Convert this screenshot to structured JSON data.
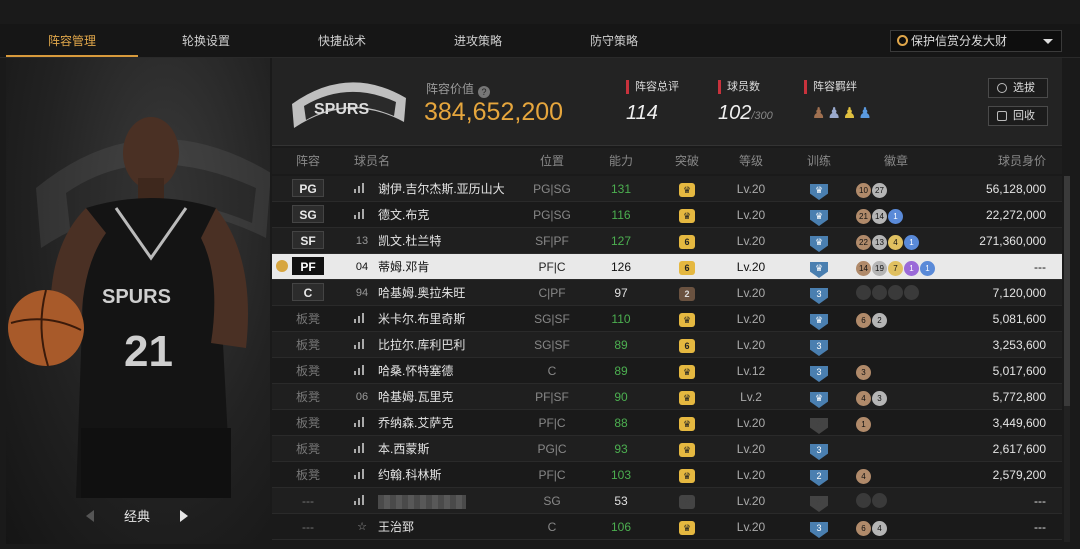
{
  "tabs": [
    {
      "label": "阵容管理",
      "active": true
    },
    {
      "label": "轮换设置",
      "active": false
    },
    {
      "label": "快捷战术",
      "active": false
    },
    {
      "label": "进攻策略",
      "active": false
    },
    {
      "label": "防守策略",
      "active": false
    }
  ],
  "dropdown": {
    "label": "保护信赏分发大财"
  },
  "left_nav": {
    "label": "经典"
  },
  "team": {
    "value_label": "阵容价值",
    "value": "384,652,200",
    "overall_label": "阵容总评",
    "overall": "114",
    "count_label": "球员数",
    "count": "102",
    "count_max": "/300",
    "bond_label": "阵容羁绊"
  },
  "buttons": {
    "select": "选拔",
    "recycle": "回收"
  },
  "columns": [
    "阵容",
    "球员名",
    "位置",
    "能力",
    "突破",
    "等级",
    "训练",
    "徽章",
    "球员身价"
  ],
  "players": [
    {
      "slot": "PG",
      "num": "",
      "name": "谢伊.吉尔杰斯.亚历山大",
      "pos": "PG|SG",
      "ovr": "131",
      "brk": "",
      "lvl": "Lv.20",
      "trn": "",
      "badges": [
        {
          "t": "10",
          "c": "bronze"
        },
        {
          "t": "27",
          "c": "silver"
        }
      ],
      "salary": "56,128,000"
    },
    {
      "slot": "SG",
      "num": "",
      "name": "德文.布克",
      "pos": "PG|SG",
      "ovr": "116",
      "brk": "",
      "lvl": "Lv.20",
      "trn": "",
      "badges": [
        {
          "t": "21",
          "c": "bronze"
        },
        {
          "t": "14",
          "c": "silver"
        },
        {
          "t": "1",
          "c": "blue"
        }
      ],
      "salary": "22,272,000"
    },
    {
      "slot": "SF",
      "num": "13",
      "name": "凯文.杜兰特",
      "pos": "SF|PF",
      "ovr": "127",
      "brk": "6",
      "lvl": "Lv.20",
      "trn": "",
      "badges": [
        {
          "t": "22",
          "c": "bronze"
        },
        {
          "t": "13",
          "c": "silver"
        },
        {
          "t": "4",
          "c": "gold"
        },
        {
          "t": "1",
          "c": "blue"
        }
      ],
      "salary": "271,360,000"
    },
    {
      "slot": "PF",
      "num": "04",
      "name": "蒂姆.邓肯",
      "pos": "PF|C",
      "ovr": "126",
      "brk": "6",
      "lvl": "Lv.20",
      "trn": "",
      "badges": [
        {
          "t": "14",
          "c": "bronze"
        },
        {
          "t": "19",
          "c": "silver"
        },
        {
          "t": "7",
          "c": "gold"
        },
        {
          "t": "1",
          "c": "purple"
        },
        {
          "t": "1",
          "c": "blue"
        }
      ],
      "salary": "---",
      "selected": true
    },
    {
      "slot": "C",
      "num": "94",
      "name": "哈基姆.奥拉朱旺",
      "pos": "C|PF",
      "ovr": "97",
      "brk": "2",
      "lvl": "Lv.20",
      "trn": "3",
      "badges": [
        {
          "t": "",
          "c": "dark"
        },
        {
          "t": "",
          "c": "dark"
        },
        {
          "t": "",
          "c": "dark"
        },
        {
          "t": "",
          "c": "dark"
        }
      ],
      "salary": "7,120,000"
    },
    {
      "slot": "板凳",
      "num": "",
      "name": "米卡尔.布里奇斯",
      "pos": "SG|SF",
      "ovr": "110",
      "brk": "",
      "lvl": "Lv.20",
      "trn": "",
      "badges": [
        {
          "t": "6",
          "c": "bronze"
        },
        {
          "t": "2",
          "c": "silver"
        }
      ],
      "salary": "5,081,600"
    },
    {
      "slot": "板凳",
      "num": "",
      "name": "比拉尔.库利巴利",
      "pos": "SG|SF",
      "ovr": "89",
      "brk": "6",
      "lvl": "Lv.20",
      "trn": "3",
      "badges": [],
      "salary": "3,253,600"
    },
    {
      "slot": "板凳",
      "num": "",
      "name": "哈桑.怀特塞德",
      "pos": "C",
      "ovr": "89",
      "brk": "",
      "lvl": "Lv.12",
      "trn": "3",
      "badges": [
        {
          "t": "3",
          "c": "bronze"
        }
      ],
      "salary": "5,017,600"
    },
    {
      "slot": "板凳",
      "num": "06",
      "name": "哈基姆.瓦里克",
      "pos": "PF|SF",
      "ovr": "90",
      "brk": "",
      "lvl": "Lv.2",
      "trn": "",
      "badges": [
        {
          "t": "4",
          "c": "bronze"
        },
        {
          "t": "3",
          "c": "silver"
        }
      ],
      "salary": "5,772,800"
    },
    {
      "slot": "板凳",
      "num": "",
      "name": "乔纳森.艾萨克",
      "pos": "PF|C",
      "ovr": "88",
      "brk": "",
      "lvl": "Lv.20",
      "trn": "",
      "badges": [
        {
          "t": "1",
          "c": "bronze"
        }
      ],
      "salary": "3,449,600"
    },
    {
      "slot": "板凳",
      "num": "",
      "name": "本.西蒙斯",
      "pos": "PG|C",
      "ovr": "93",
      "brk": "",
      "lvl": "Lv.20",
      "trn": "3",
      "badges": [],
      "salary": "2,617,600"
    },
    {
      "slot": "板凳",
      "num": "",
      "name": "约翰.科林斯",
      "pos": "PF|C",
      "ovr": "103",
      "brk": "",
      "lvl": "Lv.20",
      "trn": "2",
      "badges": [
        {
          "t": "4",
          "c": "bronze"
        }
      ],
      "salary": "2,579,200"
    },
    {
      "slot": "---",
      "num": "",
      "name": "",
      "pos": "SG",
      "ovr": "53",
      "brk": "",
      "lvl": "Lv.20",
      "trn": "",
      "badges": [
        {
          "t": "",
          "c": "dark"
        },
        {
          "t": "",
          "c": "dark"
        }
      ],
      "salary": "---",
      "blurred": true
    },
    {
      "slot": "---",
      "num": "",
      "name": "王治郅",
      "pos": "C",
      "ovr": "106",
      "brk": "",
      "lvl": "Lv.20",
      "trn": "3",
      "badges": [
        {
          "t": "6",
          "c": "bronze"
        },
        {
          "t": "4",
          "c": "silver"
        }
      ],
      "salary": "---"
    }
  ]
}
